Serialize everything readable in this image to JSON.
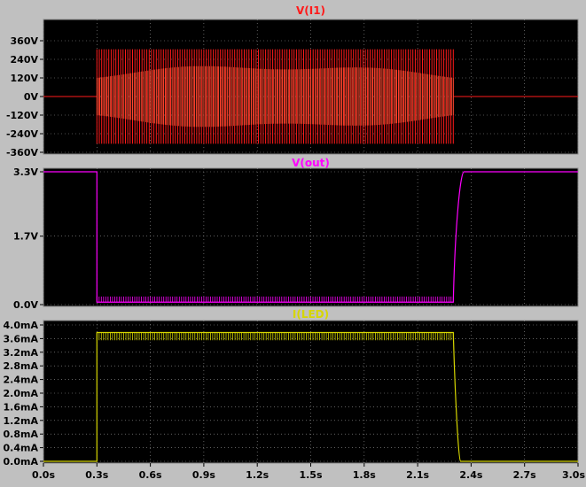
{
  "window": {
    "background": "#c0c0c0",
    "plot_background": "#000000",
    "grid_color": "#9a9a9a",
    "label_color": "#000000"
  },
  "chart_data": [
    {
      "type": "line",
      "title": "V(I1)",
      "color": "#ff1a1a",
      "ylim": [
        -360,
        360
      ],
      "yticks": [
        {
          "value": 360,
          "label": "360V"
        },
        {
          "value": 240,
          "label": "240V"
        },
        {
          "value": 120,
          "label": "120V"
        },
        {
          "value": 0,
          "label": "0V"
        },
        {
          "value": -120,
          "label": "-120V"
        },
        {
          "value": -240,
          "label": "-240V"
        },
        {
          "value": -360,
          "label": "-360V"
        }
      ],
      "series": [
        {
          "kind": "switching-ac",
          "x_start": 0.3,
          "x_end": 2.3,
          "peak": 305,
          "inner_min": 120,
          "inner_max": 230,
          "baseline": 0
        }
      ]
    },
    {
      "type": "line",
      "title": "V(out)",
      "color": "#ff00ff",
      "ylim": [
        0,
        3.3
      ],
      "yticks": [
        {
          "value": 3.3,
          "label": "3.3V"
        },
        {
          "value": 1.7,
          "label": "1.7V"
        },
        {
          "value": 0.0,
          "label": "0.0V"
        }
      ],
      "series": [
        {
          "kind": "step",
          "high": 3.3,
          "low": 0.06,
          "ripple_top": 0.2,
          "fall_at": 0.3,
          "rise_at": 2.3,
          "rise_end": 2.36
        }
      ]
    },
    {
      "type": "line",
      "title": "I(LED)",
      "color": "#d6d600",
      "ylim": [
        0,
        4.0
      ],
      "yticks": [
        {
          "value": 4.0,
          "label": "4.0mA"
        },
        {
          "value": 3.6,
          "label": "3.6mA"
        },
        {
          "value": 3.2,
          "label": "3.2mA"
        },
        {
          "value": 2.8,
          "label": "2.8mA"
        },
        {
          "value": 2.4,
          "label": "2.4mA"
        },
        {
          "value": 2.0,
          "label": "2.0mA"
        },
        {
          "value": 1.6,
          "label": "1.6mA"
        },
        {
          "value": 1.2,
          "label": "1.2mA"
        },
        {
          "value": 0.8,
          "label": "0.8mA"
        },
        {
          "value": 0.4,
          "label": "0.4mA"
        },
        {
          "value": 0.0,
          "label": "0.0mA"
        }
      ],
      "series": [
        {
          "kind": "pulse",
          "low": 0.0,
          "high": 3.78,
          "ripple_bottom": 3.55,
          "rise_at": 0.3,
          "fall_at": 2.3,
          "fall_end": 2.34
        }
      ]
    }
  ],
  "x_axis": {
    "xlim": [
      0.0,
      3.0
    ],
    "ticks": [
      {
        "value": 0.0,
        "label": "0.0s"
      },
      {
        "value": 0.3,
        "label": "0.3s"
      },
      {
        "value": 0.6,
        "label": "0.6s"
      },
      {
        "value": 0.9,
        "label": "0.9s"
      },
      {
        "value": 1.2,
        "label": "1.2s"
      },
      {
        "value": 1.5,
        "label": "1.5s"
      },
      {
        "value": 1.8,
        "label": "1.8s"
      },
      {
        "value": 2.1,
        "label": "2.1s"
      },
      {
        "value": 2.4,
        "label": "2.4s"
      },
      {
        "value": 2.7,
        "label": "2.7s"
      },
      {
        "value": 3.0,
        "label": "3.0s"
      }
    ]
  }
}
